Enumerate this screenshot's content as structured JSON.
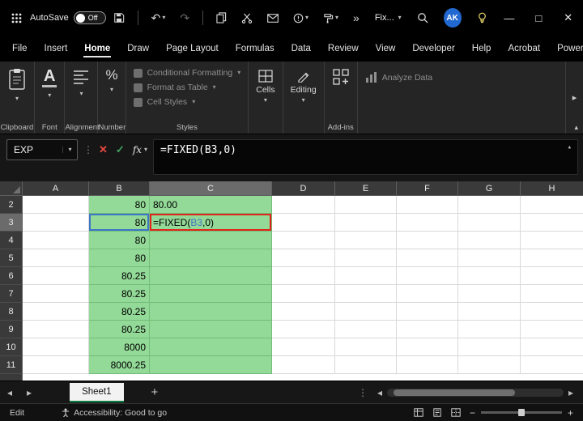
{
  "title_bar": {
    "autosave_label": "AutoSave",
    "autosave_state": "Off",
    "doc_name": "Fix...",
    "avatar_initials": "AK"
  },
  "menu_bar": {
    "items": [
      "File",
      "Insert",
      "Home",
      "Draw",
      "Page Layout",
      "Formulas",
      "Data",
      "Review",
      "View",
      "Developer",
      "Help",
      "Acrobat",
      "Power Pivot"
    ],
    "active_item": "Home"
  },
  "ribbon": {
    "groups": {
      "clipboard": "Clipboard",
      "font": "Font",
      "alignment": "Alignment",
      "number": "Number",
      "styles": "Styles",
      "addins": "Add-ins"
    },
    "styles_buttons": [
      "Conditional Formatting",
      "Format as Table",
      "Cell Styles"
    ],
    "cells_label": "Cells",
    "editing_label": "Editing",
    "analyze_data_label": "Analyze Data"
  },
  "formula_bar": {
    "name_box_value": "EXP",
    "fx_label": "fx",
    "formula": "=FIXED(B3,0)"
  },
  "grid": {
    "column_headers": [
      "A",
      "B",
      "C",
      "D",
      "E",
      "F",
      "G",
      "H"
    ],
    "active_column": "C",
    "active_row": "3",
    "editing_cell": {
      "formula_pre": "=FIXED(",
      "formula_ref": "B3",
      "formula_post": ",0)"
    },
    "rows": [
      {
        "num": "2",
        "b": "80",
        "c": "80.00"
      },
      {
        "num": "3",
        "b": "80",
        "c": ""
      },
      {
        "num": "4",
        "b": "80",
        "c": ""
      },
      {
        "num": "5",
        "b": "80",
        "c": ""
      },
      {
        "num": "6",
        "b": "80.25",
        "c": ""
      },
      {
        "num": "7",
        "b": "80.25",
        "c": ""
      },
      {
        "num": "8",
        "b": "80.25",
        "c": ""
      },
      {
        "num": "9",
        "b": "80.25",
        "c": ""
      },
      {
        "num": "10",
        "b": "8000",
        "c": ""
      },
      {
        "num": "11",
        "b": "8000.25",
        "c": ""
      }
    ]
  },
  "sheet_bar": {
    "tabs": [
      {
        "label": "Sheet1",
        "active": true
      }
    ]
  },
  "status_bar": {
    "mode": "Edit",
    "accessibility": "Accessibility: Good to go"
  },
  "colors": {
    "accent_green": "#107C41",
    "cell_fill_green": "#93D997",
    "reference_blue": "#4472C4",
    "editing_border_red": "#E2231A",
    "avatar_blue": "#2268D1"
  }
}
